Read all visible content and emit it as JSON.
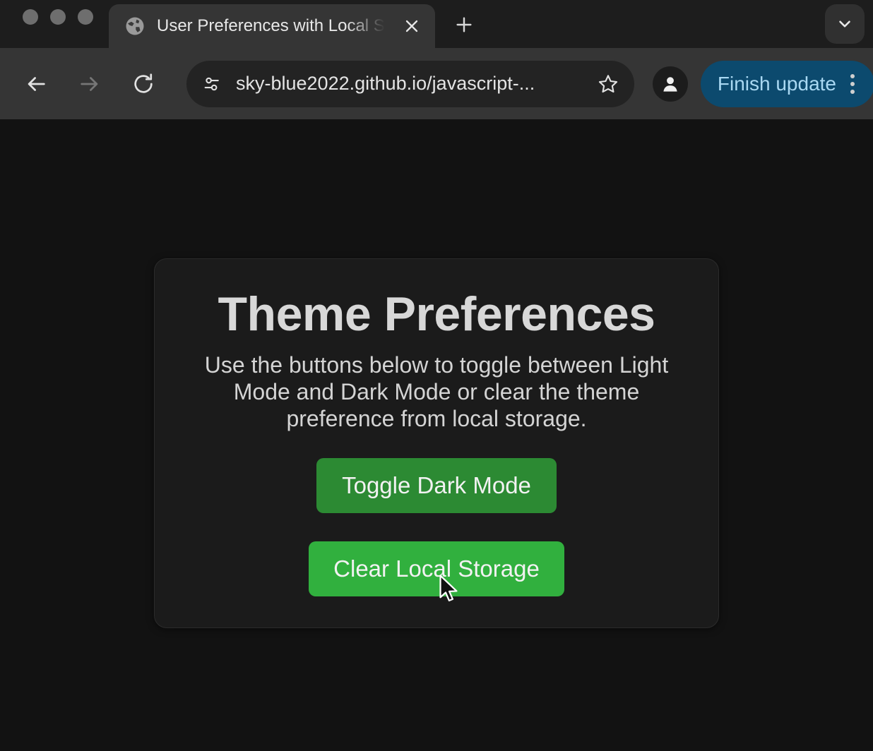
{
  "browser": {
    "window_controls": [
      "close",
      "minimize",
      "maximize"
    ],
    "tab": {
      "title": "User Preferences with Local S",
      "favicon": "globe-icon",
      "close_label": "×"
    },
    "new_tab_label": "+",
    "tab_search": "chevron-down-icon",
    "toolbar": {
      "back": "back-arrow-icon",
      "forward": "forward-arrow-icon",
      "reload": "reload-icon",
      "site_info": "tune-icon",
      "url": "sky-blue2022.github.io/javascript-...",
      "bookmark": "star-icon",
      "profile": "profile-avatar-icon",
      "update_label": "Finish update",
      "menu": "kebab-menu-icon"
    }
  },
  "page": {
    "title": "Theme Preferences",
    "description": "Use the buttons below to toggle between Light Mode and Dark Mode or clear the theme preference from local storage.",
    "toggle_button_label": "Toggle Dark Mode",
    "clear_button_label": "Clear Local Storage"
  },
  "colors": {
    "page_background": "#121212",
    "card_background": "#1b1b1b",
    "toggle_button": "#2c8a33",
    "clear_button": "#31b03e",
    "update_pill": "#0c4a6e",
    "update_text": "#a9d8f2",
    "toolbar": "#353535"
  }
}
